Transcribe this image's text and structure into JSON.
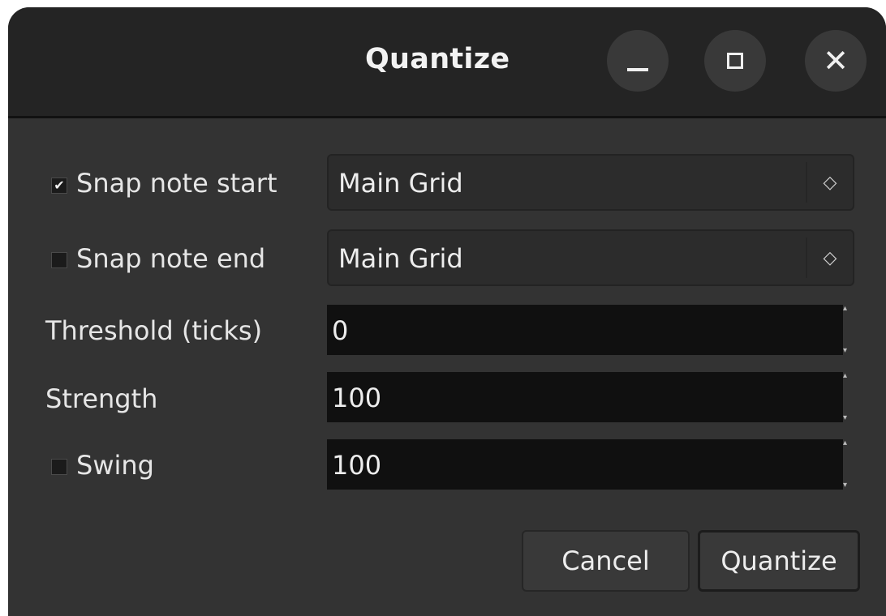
{
  "window": {
    "title": "Quantize",
    "controls": {
      "minimize": "minimize-icon",
      "maximize": "maximize-icon",
      "close": "close-icon"
    }
  },
  "form": {
    "snap_note_start": {
      "label": "Snap note start",
      "checked": true,
      "value": "Main Grid"
    },
    "snap_note_end": {
      "label": "Snap note end",
      "checked": false,
      "value": "Main Grid"
    },
    "threshold": {
      "label": "Threshold (ticks)",
      "value": "0"
    },
    "strength": {
      "label": "Strength",
      "value": "100"
    },
    "swing": {
      "label": "Swing",
      "checked": false,
      "value": "100"
    }
  },
  "buttons": {
    "cancel": "Cancel",
    "quantize": "Quantize"
  },
  "glyphs": {
    "check": "✔",
    "combo_arrows": "◇",
    "spin_up": "▴",
    "spin_down": "▾",
    "close": "✕"
  },
  "colors": {
    "window_bg": "#333333",
    "titlebar_bg": "#242424",
    "field_bg": "#101010",
    "text": "#e6e6e6"
  }
}
